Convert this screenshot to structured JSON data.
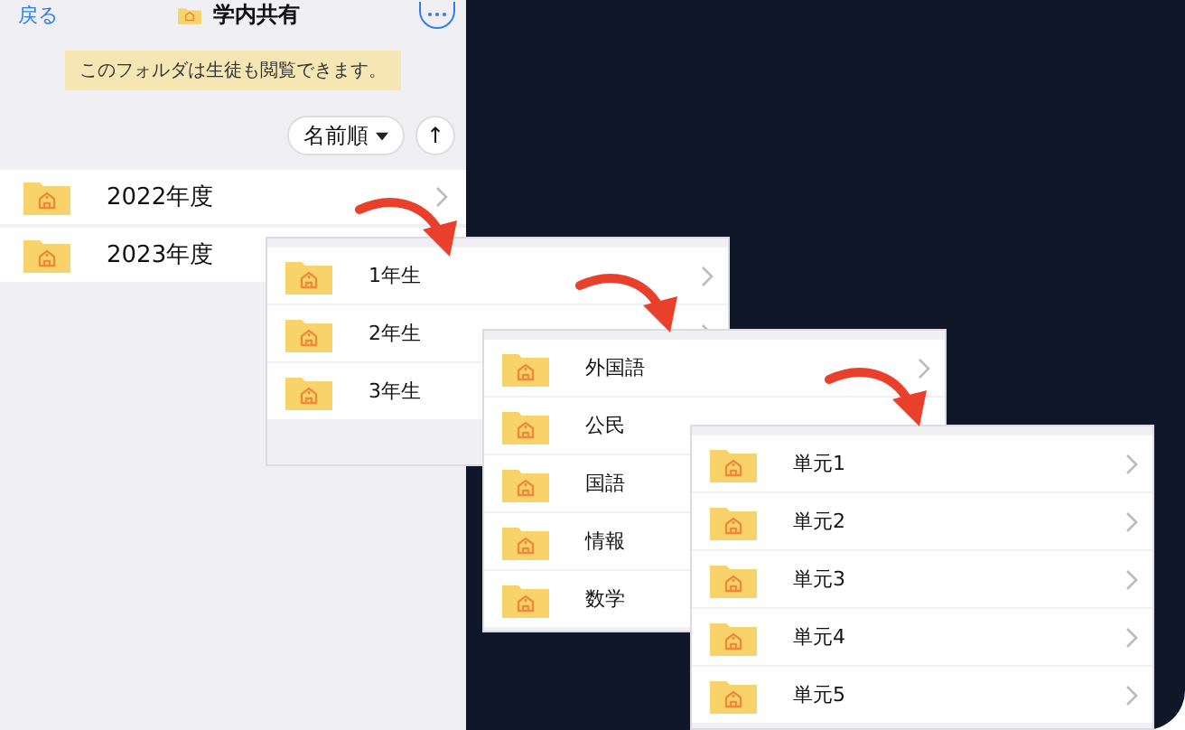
{
  "header": {
    "back": "戻る",
    "title": "学内共有"
  },
  "notice": "このフォルダは生徒も閲覧できます。",
  "sort": {
    "label": "名前順",
    "direction": "↑"
  },
  "folders": [
    {
      "name": "2022年度",
      "chevron": true
    },
    {
      "name": "2023年度"
    }
  ],
  "panels": [
    {
      "rows": [
        {
          "name": "1年生",
          "chevron": true
        },
        {
          "name": "2年生",
          "chevron": true
        },
        {
          "name": "3年生"
        }
      ]
    },
    {
      "rows": [
        {
          "name": "外国語",
          "chevron": true
        },
        {
          "name": "公民"
        },
        {
          "name": "国語"
        },
        {
          "name": "情報"
        },
        {
          "name": "数学"
        }
      ]
    },
    {
      "rows": [
        {
          "name": "単元1",
          "chevron": true
        },
        {
          "name": "単元2",
          "chevron": true
        },
        {
          "name": "単元3",
          "chevron": true
        },
        {
          "name": "単元4",
          "chevron": true
        },
        {
          "name": "単元5",
          "chevron": true
        }
      ]
    }
  ]
}
